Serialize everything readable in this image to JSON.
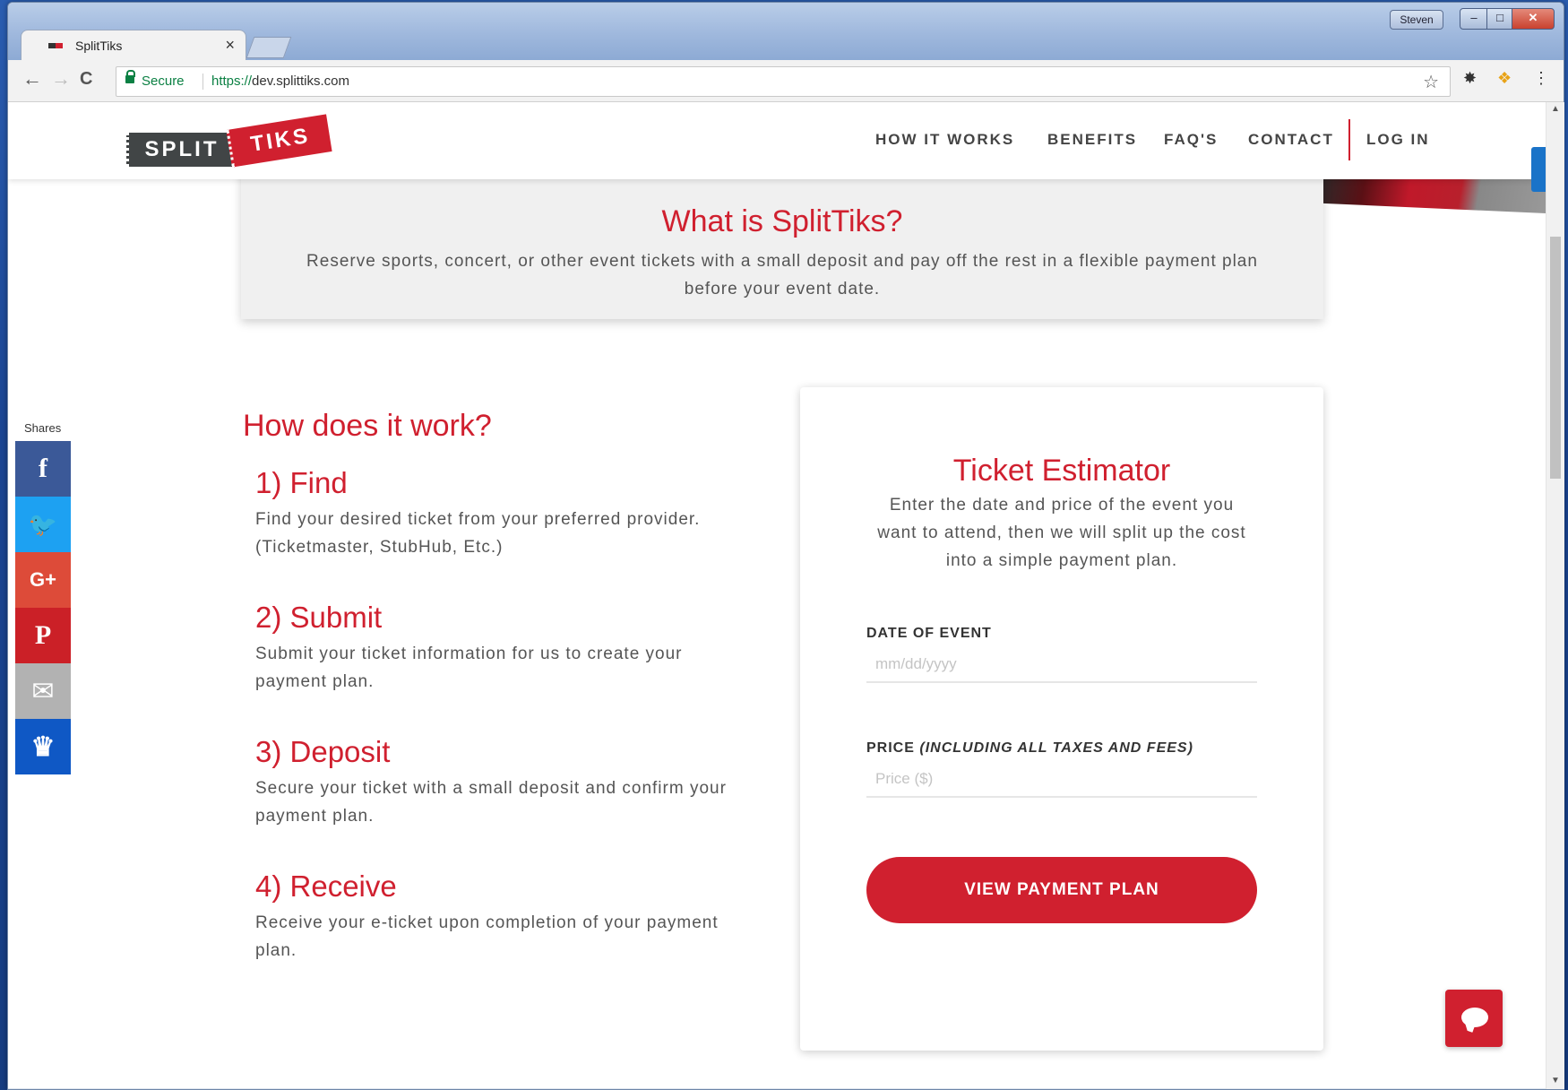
{
  "browser": {
    "tab_title": "SplitTiks",
    "tab_close": "×",
    "user": "Steven",
    "win_min": "–",
    "win_max": "□",
    "win_close": "✕",
    "back": "←",
    "forward": "→",
    "reload": "C",
    "secure_label": "Secure",
    "url_protocol": "https://",
    "url_host": "dev.splittiks.com",
    "star": "☆",
    "extension_icon": "✸",
    "extension2_icon": "❖",
    "menu_icon": "⋮"
  },
  "site": {
    "logo_left": "SPLIT",
    "logo_right": "TIKS",
    "nav": {
      "how_it_works": "HOW IT WORKS",
      "benefits": "BENEFITS",
      "faqs": "FAQ'S",
      "contact": "CONTACT",
      "login": "LOG IN"
    }
  },
  "whatis": {
    "title": "What is SplitTiks?",
    "description": "Reserve sports, concert, or other event tickets with a small deposit and pay off the rest in a flexible payment plan before your event date."
  },
  "share": {
    "label": "Shares",
    "facebook": "f",
    "twitter": "🐦",
    "googleplus": "G+",
    "pinterest": "P",
    "email": "✉",
    "sumo": "♛",
    "colors": {
      "facebook": "#3b5998",
      "twitter": "#1da1f2",
      "googleplus": "#dd4b39",
      "pinterest": "#cb2027",
      "email": "#b2b2b2",
      "sumo": "#0f58c5"
    }
  },
  "how": {
    "title": "How does it work?",
    "steps": [
      {
        "title": "1) Find",
        "desc": "Find your desired ticket from your preferred provider. (Ticketmaster, StubHub, Etc.)"
      },
      {
        "title": "2) Submit",
        "desc": "Submit your ticket information for us to create your payment plan."
      },
      {
        "title": "3) Deposit",
        "desc": "Secure your ticket with a small deposit and confirm your payment plan."
      },
      {
        "title": "4) Receive",
        "desc": "Receive your e-ticket upon completion of your payment plan."
      }
    ]
  },
  "estimator": {
    "title": "Ticket Estimator",
    "description": "Enter the date and price of the event you want to attend, then we will split up the cost into a simple payment plan.",
    "date_label": "DATE OF EVENT",
    "date_placeholder": "mm/dd/yyyy",
    "price_label": "PRICE",
    "price_label_note": "(INCLUDING ALL TAXES AND FEES)",
    "price_placeholder": "Price ($)",
    "button": "VIEW PAYMENT PLAN"
  },
  "colors": {
    "brand_red": "#d0202f",
    "logo_dark": "#414546"
  }
}
